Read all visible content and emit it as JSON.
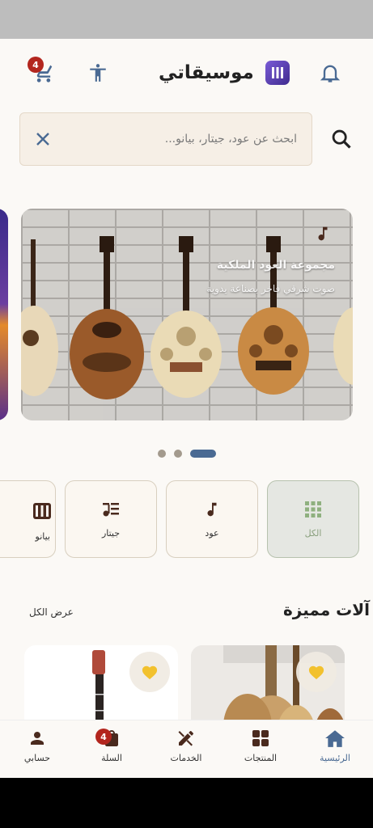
{
  "header": {
    "app_title": "موسيقاتي",
    "cart_count": "4"
  },
  "search": {
    "placeholder": "ابحث عن عود، جيتار، بيانو..."
  },
  "carousel": {
    "slide_title": "مجموعة العود الملكية",
    "slide_subtitle": "صوت شرقي فاخر بصناعة يدوية",
    "dot_count": 3,
    "active_dot": 2
  },
  "categories": [
    {
      "label": "الكل",
      "icon": "grid-icon",
      "active": true
    },
    {
      "label": "عود",
      "icon": "music-note-icon",
      "active": false
    },
    {
      "label": "جيتار",
      "icon": "guitar-list-icon",
      "active": false
    },
    {
      "label": "بيانو",
      "icon": "piano-icon",
      "active": false
    }
  ],
  "featured": {
    "title": "آلات مميزة",
    "view_all": "عرض الكل"
  },
  "bottom_nav": [
    {
      "label": "الرئيسية",
      "icon": "home-icon",
      "active": true
    },
    {
      "label": "المنتجات",
      "icon": "grid-icon",
      "active": false
    },
    {
      "label": "الخدمات",
      "icon": "tools-icon",
      "active": false
    },
    {
      "label": "السلة",
      "icon": "bag-icon",
      "active": false,
      "badge": "4"
    },
    {
      "label": "حسابي",
      "icon": "person-icon",
      "active": false
    }
  ],
  "colors": {
    "accent": "#4a6a93",
    "badge": "#b3261e",
    "favorite": "#f2c12e",
    "brown": "#4a2a1e"
  }
}
